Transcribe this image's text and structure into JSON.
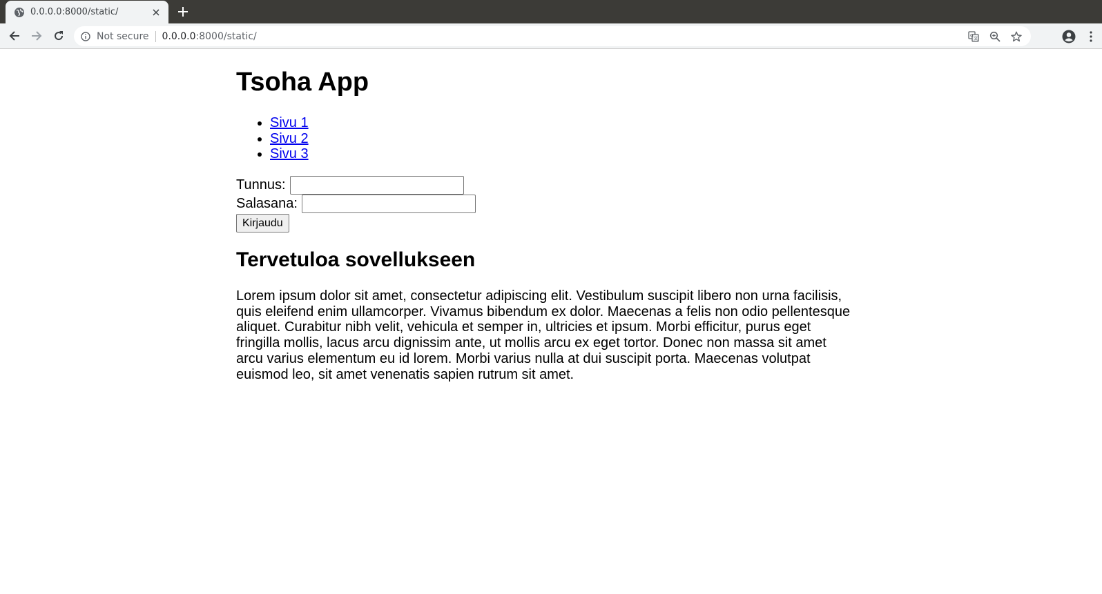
{
  "browser": {
    "tab": {
      "title": "0.0.0.0:8000/static/"
    },
    "address_bar": {
      "security_label": "Not secure",
      "host": "0.0.0.0",
      "path": ":8000/static/"
    },
    "icons": {
      "tab_favicon": "globe-icon",
      "tab_close": "close-icon",
      "new_tab": "plus-icon",
      "back": "back-arrow-icon",
      "forward": "forward-arrow-icon",
      "reload": "reload-icon",
      "info": "info-icon",
      "translate": "translate-icon",
      "zoom": "zoom-icon",
      "bookmark": "star-icon",
      "profile": "profile-icon",
      "menu": "kebab-menu-icon"
    },
    "colors": {
      "tabstrip": "#3c3b37",
      "toolbar": "#f1f3f4",
      "link": "#0000ee"
    }
  },
  "page": {
    "title": "Tsoha App",
    "nav_links": [
      {
        "label": "Sivu 1"
      },
      {
        "label": "Sivu 2"
      },
      {
        "label": "Sivu 3"
      }
    ],
    "login": {
      "username_label": "Tunnus:",
      "username_value": "",
      "password_label": "Salasana:",
      "password_value": "",
      "submit_label": "Kirjaudu"
    },
    "welcome_heading": "Tervetuloa sovellukseen",
    "body_text": "Lorem ipsum dolor sit amet, consectetur adipiscing elit. Vestibulum suscipit libero non urna facilisis, quis eleifend enim ullamcorper. Vivamus bibendum ex dolor. Maecenas a felis non odio pellentesque aliquet. Curabitur nibh velit, vehicula et semper in, ultricies et ipsum. Morbi efficitur, purus eget fringilla mollis, lacus arcu dignissim ante, ut mollis arcu ex eget tortor. Donec non massa sit amet arcu varius elementum eu id lorem. Morbi varius nulla at dui suscipit porta. Maecenas volutpat euismod leo, sit amet venenatis sapien rutrum sit amet."
  }
}
